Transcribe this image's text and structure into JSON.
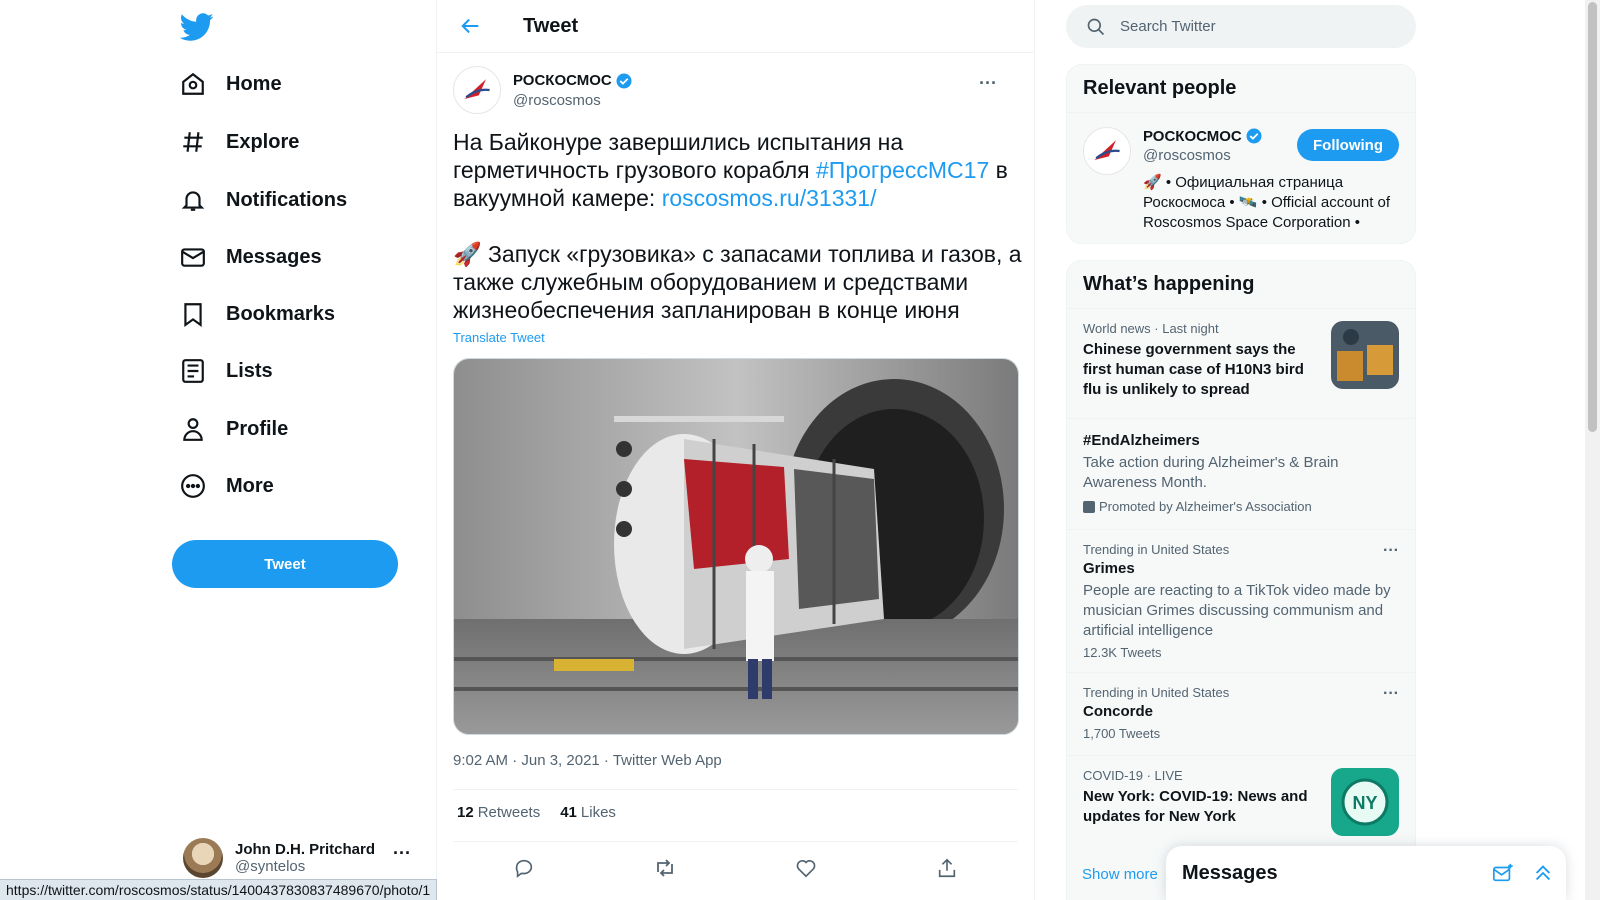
{
  "nav": {
    "items": [
      {
        "label": "Home",
        "icon": "home-icon"
      },
      {
        "label": "Explore",
        "icon": "hashtag-icon"
      },
      {
        "label": "Notifications",
        "icon": "bell-icon"
      },
      {
        "label": "Messages",
        "icon": "envelope-icon"
      },
      {
        "label": "Bookmarks",
        "icon": "bookmark-icon"
      },
      {
        "label": "Lists",
        "icon": "list-icon"
      },
      {
        "label": "Profile",
        "icon": "person-icon"
      },
      {
        "label": "More",
        "icon": "more-circle-icon"
      }
    ],
    "tweet_button": "Tweet",
    "account": {
      "name": "John D.H. Pritchard",
      "handle": "@syntelos",
      "more": "···"
    }
  },
  "main": {
    "title": "Tweet",
    "author": {
      "name": "РОСКОСМОС",
      "handle": "@roscosmos"
    },
    "more": "···",
    "text": {
      "line1_plain": "На Байконуре завершились испытания на герметичность грузового корабля ",
      "hashtag": "#ПрогрессМС17",
      "line1_mid": " в вакуумной камере: ",
      "link": "roscosmos.ru/31331/",
      "para2": "🚀 Запуск «грузовика» с запасами топлива и газов, а также служебным оборудованием и средствами жизнеобеспечения запланирован в конце июня"
    },
    "translate": "Translate Tweet",
    "meta": "9:02 AM · Jun 3, 2021 · Twitter Web App",
    "stats": {
      "retweets_count": "12",
      "retweets_label": "Retweets",
      "likes_count": "41",
      "likes_label": "Likes"
    }
  },
  "right": {
    "search_placeholder": "Search Twitter",
    "relevant": {
      "title": "Relevant people",
      "name": "РОСКОСМОС",
      "handle": "@roscosmos",
      "follow_label": "Following",
      "bio": "🚀 • Официальная страница Роскосмоса • 🛰️ • Official account of Roscosmos Space Corporation •"
    },
    "happening": {
      "title": "What’s happening",
      "trends": [
        {
          "meta": "World news · Last night",
          "title": "Chinese government says the first human case of H10N3 bird flu is unlikely to spread"
        },
        {
          "title": "#EndAlzheimers",
          "desc": "Take action during Alzheimer's & Brain Awareness Month.",
          "promo": "Promoted by Alzheimer's Association"
        },
        {
          "meta": "Trending in United States",
          "title": "Grimes",
          "desc": "People are reacting to a TikTok video made by musician Grimes discussing communism and artificial intelligence",
          "count": "12.3K Tweets"
        },
        {
          "meta": "Trending in United States",
          "title": "Concorde",
          "count": "1,700 Tweets"
        },
        {
          "meta": "COVID-19 · LIVE",
          "title": "New York: COVID-19: News and updates for New York",
          "thumb_text": "NY"
        }
      ],
      "show_more": "Show more"
    }
  },
  "messages": {
    "title": "Messages"
  },
  "status_url": "https://twitter.com/roscosmos/status/1400437830837489670/photo/1",
  "colors": {
    "accent": "#1d9bf0",
    "text": "#0f1419",
    "secondary": "#536471"
  }
}
